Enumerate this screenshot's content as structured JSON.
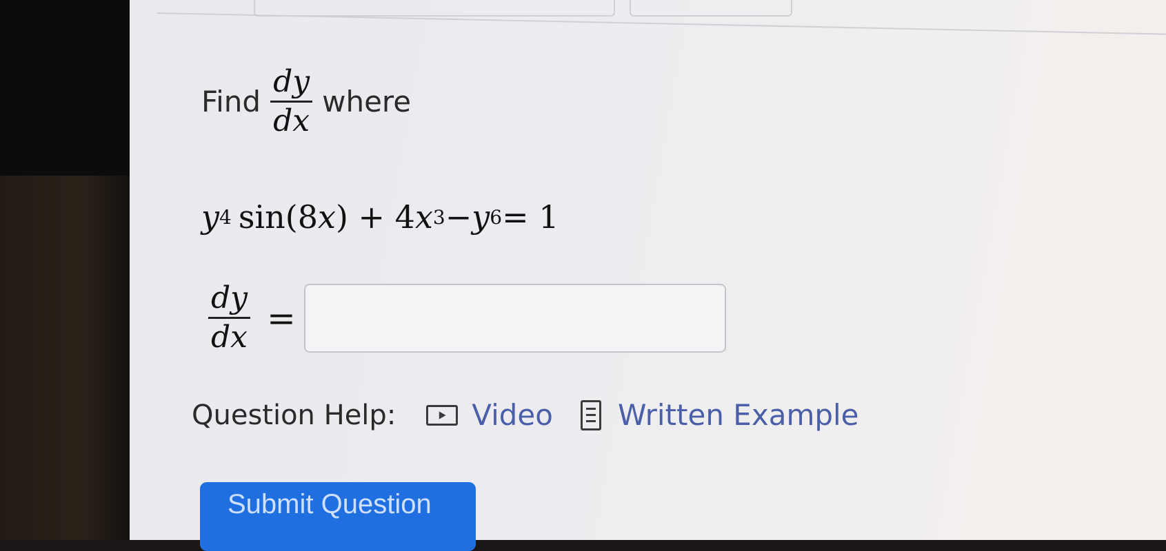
{
  "question": {
    "find_word": "Find",
    "deriv_num": "dy",
    "deriv_den": "dx",
    "where_word": "where",
    "equation": {
      "y": "y",
      "y_exp": "4",
      "sin": "sin(8",
      "x1": "x",
      "close": ") + 4",
      "x2": "x",
      "x_exp": "3",
      "minus": " − ",
      "y2": "y",
      "y2_exp": "6",
      "rhs": " = 1"
    }
  },
  "answer": {
    "num": "dy",
    "den": "dx",
    "equals": "=",
    "value": ""
  },
  "help": {
    "label": "Question Help:",
    "video_label": "Video",
    "example_label": "Written Example",
    "video_icon": "play-icon",
    "example_icon": "document-icon"
  },
  "submit": {
    "label": "Submit Question"
  },
  "colors": {
    "link": "#4a5fa8",
    "submit_bg": "#1f6fe0"
  }
}
